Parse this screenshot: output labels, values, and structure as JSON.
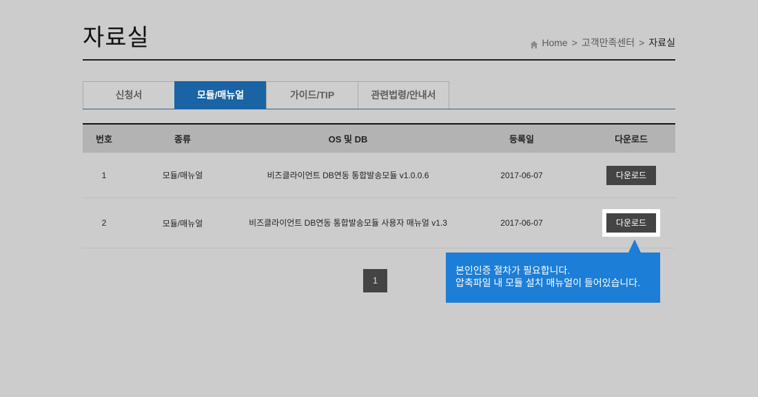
{
  "page": {
    "title": "자료실"
  },
  "breadcrumb": {
    "home_icon": "home-icon",
    "items": [
      "Home",
      "고객만족센터",
      "자료실"
    ],
    "separator": ">"
  },
  "tabs": [
    {
      "label": "신청서",
      "active": false
    },
    {
      "label": "모듈/매뉴얼",
      "active": true
    },
    {
      "label": "가이드/TIP",
      "active": false
    },
    {
      "label": "관련법령/안내서",
      "active": false
    }
  ],
  "table": {
    "headers": [
      "번호",
      "종류",
      "OS 및 DB",
      "등록일",
      "다운로드"
    ],
    "rows": [
      {
        "no": "1",
        "type": "모듈/매뉴얼",
        "name": "비즈클라이언트 DB연동 통합발송모듈 v1.0.0.6",
        "date": "2017-06-07",
        "download_label": "다운로드",
        "highlighted": false
      },
      {
        "no": "2",
        "type": "모듈/매뉴얼",
        "name": "비즈클라이언트 DB연동 통합발송모듈 사용자 매뉴얼 v1.3",
        "date": "2017-06-07",
        "download_label": "다운로드",
        "highlighted": true
      }
    ]
  },
  "pagination": {
    "pages": [
      {
        "label": "1",
        "active": true
      }
    ]
  },
  "tooltip": {
    "lines": [
      "본인인증 절차가 필요합니다.",
      "압축파일 내 모듈 설치 매뉴얼이 들어있습니다."
    ]
  },
  "colors": {
    "background": "#cccccc",
    "active_tab": "#1a63a5",
    "tooltip": "#1c7ed6",
    "button": "#444444",
    "header_row": "#b3b3b3"
  }
}
